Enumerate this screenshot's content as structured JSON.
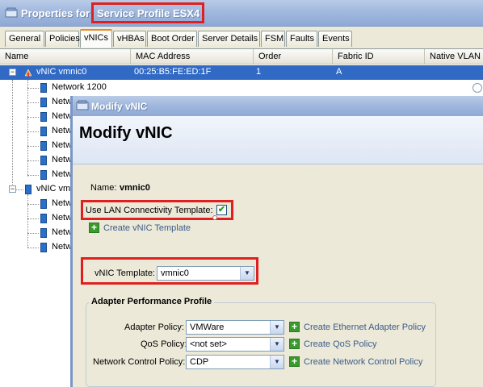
{
  "window": {
    "title_prefix": "Properties for",
    "title_name": "Service Profile ESX4"
  },
  "tabs": [
    {
      "label": "General"
    },
    {
      "label": "Policies"
    },
    {
      "label": "vNICs"
    },
    {
      "label": "vHBAs"
    },
    {
      "label": "Boot Order"
    },
    {
      "label": "Server Details"
    },
    {
      "label": "FSM"
    },
    {
      "label": "Faults"
    },
    {
      "label": "Events"
    }
  ],
  "table": {
    "columns": [
      "Name",
      "MAC Address",
      "Order",
      "Fabric ID",
      "Native VLAN"
    ],
    "selected_row": {
      "name": "vNIC vmnic0",
      "mac": "00:25:B5:FE:ED:1F",
      "order": "1",
      "fabric": "A",
      "expander": "−"
    },
    "child_rows": [
      "Network 1200",
      "Netw",
      "Netw",
      "Netw",
      "Netw",
      "Netw",
      "Netw"
    ],
    "second_vnic": {
      "name": "vNIC vm",
      "expander": "−"
    },
    "second_children": [
      "Netw",
      "Netw",
      "Netw",
      "Netw"
    ]
  },
  "dialog": {
    "title": "Modify vNIC",
    "header": "Modify vNIC",
    "name_label": "Name:",
    "name_value": "vmnic0",
    "use_template_label": "Use LAN Connectivity Template:",
    "use_template_checked": true,
    "check_mark": "✔",
    "create_template_label": "Create vNIC Template",
    "plus_glyph": "+",
    "template_label": "vNIC Template:",
    "template_value": "vmnic0",
    "arrow_glyph": "▼",
    "group_title": "Adapter Performance Profile",
    "adapter_policy": {
      "label": "Adapter Policy:",
      "value": "VMWare",
      "link": "Create Ethernet Adapter Policy"
    },
    "qos_policy": {
      "label": "QoS Policy:",
      "value": "<not set>",
      "link": "Create QoS Policy"
    },
    "network_control_policy": {
      "label": "Network Control Policy:",
      "value": "CDP",
      "link": "Create Network Control Policy"
    }
  },
  "colors": {
    "highlight_box": "#e02020",
    "selection": "#316ac5",
    "title_bar": "#9fb7dd",
    "add_button": "#3b9a2e"
  }
}
